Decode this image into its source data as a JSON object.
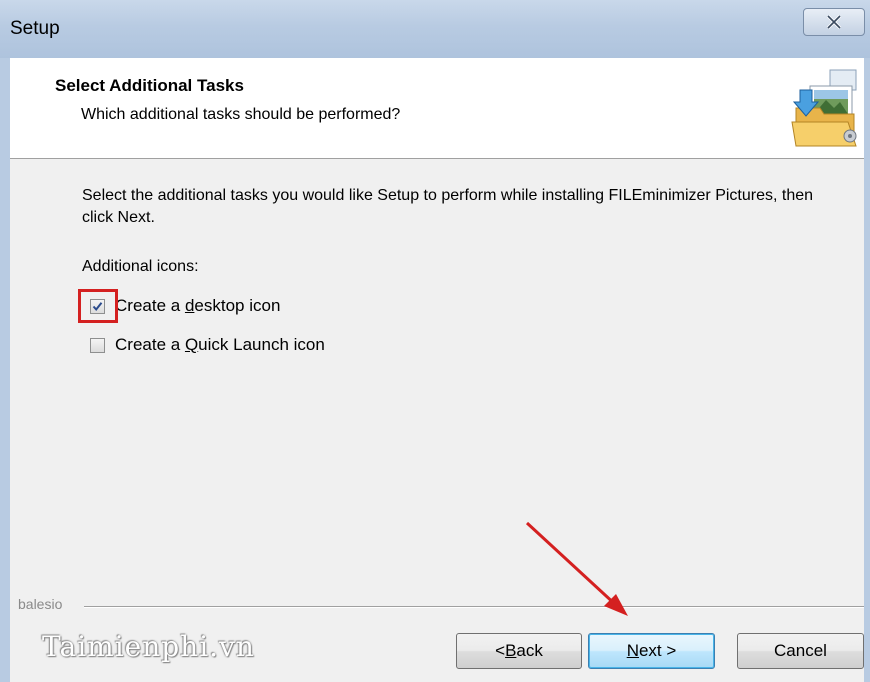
{
  "window": {
    "title": "Setup"
  },
  "header": {
    "title": "Select Additional Tasks",
    "subtitle": "Which additional tasks should be performed?"
  },
  "content": {
    "description": "Select the additional tasks you would like Setup to perform while installing FILEminimizer Pictures, then click Next.",
    "section_label": "Additional icons:",
    "tasks": [
      {
        "pre": "Create a ",
        "accel": "d",
        "post": "esktop icon",
        "checked": true
      },
      {
        "pre": "Create a ",
        "accel": "Q",
        "post": "uick Launch icon",
        "checked": false
      }
    ]
  },
  "footer": {
    "brand": "balesio",
    "watermark": "Taimienphi.vn",
    "back": {
      "pre": "< ",
      "accel": "B",
      "post": "ack"
    },
    "next": {
      "pre": "",
      "accel": "N",
      "post": "ext >"
    },
    "cancel": "Cancel"
  },
  "colors": {
    "highlight": "#d42020",
    "titlebar": "#b8cbe2",
    "default_button": "#bee6fd"
  }
}
